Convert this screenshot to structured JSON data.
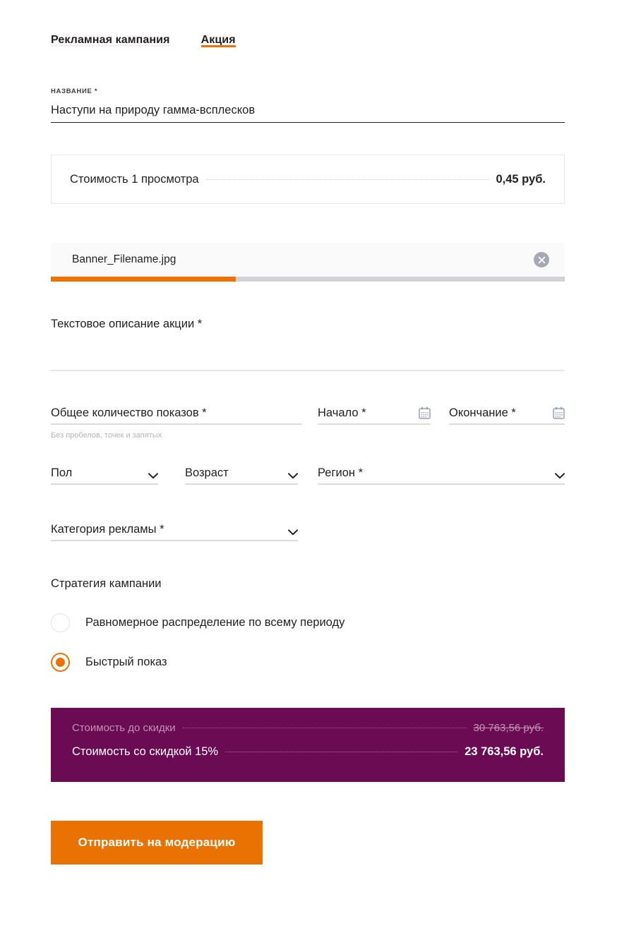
{
  "tabs": [
    {
      "label": "Рекламная кампания",
      "active": false
    },
    {
      "label": "Акция",
      "active": true
    }
  ],
  "title_field": {
    "caption": "НАЗВАНИЕ *",
    "value": "Наступи на природу гамма-всплесков",
    "placeholder": ""
  },
  "price_card": {
    "label": "Стоимость 1 просмотра",
    "value": "0,45 руб."
  },
  "upload": {
    "file_name": "Banner_Filename.jpg",
    "remove_icon": "close-circle-icon",
    "progress_percent": 36
  },
  "description": {
    "label": "Текстовое описание акции *",
    "value": ""
  },
  "fields": {
    "impressions": {
      "label": "Общее количество показов *",
      "hint": "Без пробелов, точек и запятых",
      "value": ""
    },
    "start_date": {
      "label": "Начало *",
      "value": "",
      "icon": "calendar-icon"
    },
    "end_date": {
      "label": "Окончание *",
      "value": "",
      "icon": "calendar-icon"
    },
    "gender": {
      "label": "Пол",
      "value": "",
      "icon": "chevron-down-icon"
    },
    "age": {
      "label": "Возраст",
      "value": "",
      "icon": "chevron-down-icon"
    },
    "region": {
      "label": "Регион *",
      "value": "",
      "icon": "chevron-down-icon"
    },
    "ad_category": {
      "label": "Категория рекламы *",
      "value": "",
      "icon": "chevron-down-icon"
    }
  },
  "strategy": {
    "label": "Стратегия кампании",
    "options": [
      {
        "label": "Равномерное распределение по всему периоду",
        "selected": false
      },
      {
        "label": "Быстрый показ",
        "selected": true
      }
    ]
  },
  "summary": {
    "before_label": "Стоимость до скидки",
    "before_value": "30 763,56 руб.",
    "after_label": "Стоимость со скидкой 15%",
    "after_value": "23 763,56 руб."
  },
  "submit": {
    "label": "Отправить на модерацию"
  },
  "colors": {
    "accent_orange": "#ee7203",
    "summary_purple": "#6b0b53",
    "text": "#231f20",
    "hint": "#b4b4bb",
    "line": "#dcdcde"
  }
}
